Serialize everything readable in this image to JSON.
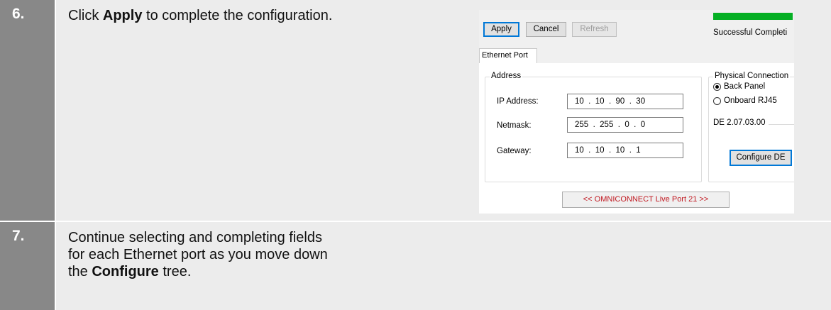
{
  "steps": [
    {
      "number": "6.",
      "text_before": "Click ",
      "text_bold": "Apply",
      "text_after": " to complete the configuration."
    },
    {
      "number": "7.",
      "line1": "Continue selecting and completing fields",
      "line2": "for each Ethernet port as you move down",
      "line3_before": "the ",
      "line3_bold": "Configure",
      "line3_after": " tree."
    }
  ],
  "screenshot": {
    "toolbar": {
      "apply_label": "Apply",
      "cancel_label": "Cancel",
      "refresh_label": "Refresh"
    },
    "status": {
      "text": "Successful Completi",
      "progress": 1.0,
      "progress_color": "#06b025"
    },
    "tab_label": "Ethernet Port",
    "address_group": {
      "title": "Address",
      "ip_label": "IP Address:",
      "ip_value": "10  .  10  .  90  .  30",
      "netmask_label": "Netmask:",
      "netmask_value": "255  .  255  .  0  .  0",
      "gateway_label": "Gateway:",
      "gateway_value": "10  .  10  .  10  .  1"
    },
    "physical_group": {
      "title": "Physical Connection",
      "options": [
        {
          "label": "Back Panel",
          "selected": true
        },
        {
          "label": "Onboard RJ45",
          "selected": false
        }
      ],
      "version_label": "DE 2.07.03.00",
      "configure_label": "Configure DE"
    },
    "live_port_label": "<< OMNICONNECT Live Port 21 >>",
    "live_port_color": "#c0171f"
  }
}
